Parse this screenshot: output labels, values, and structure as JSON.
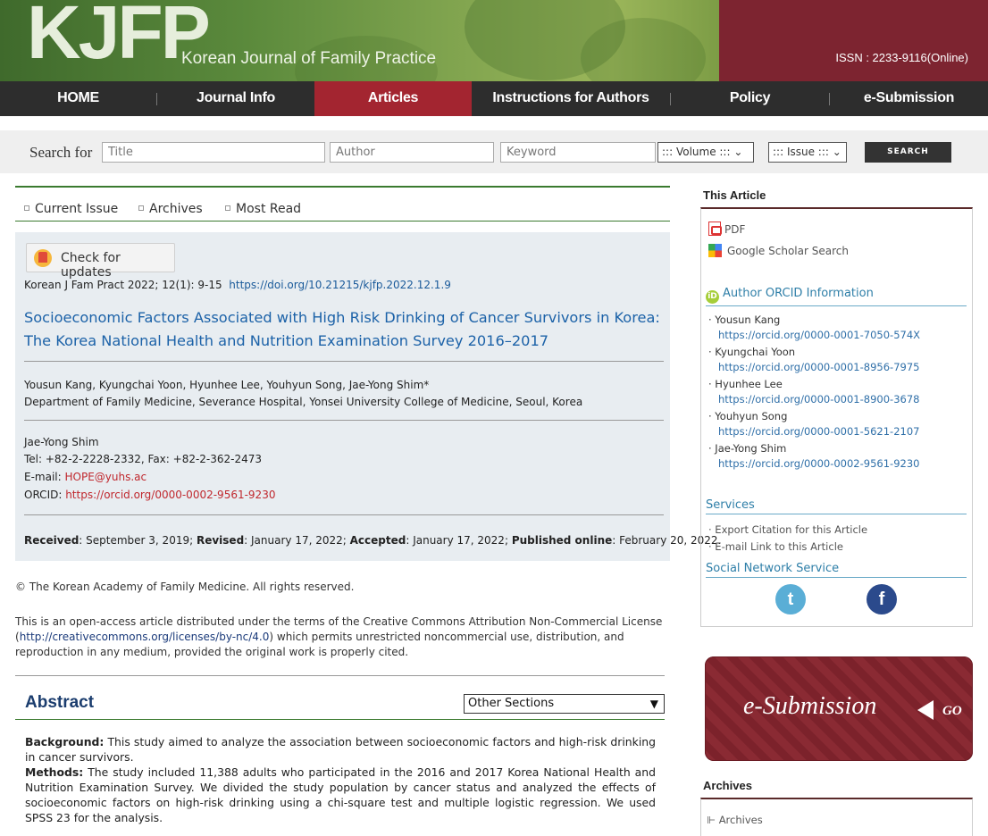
{
  "header": {
    "logo": "KJFP",
    "journal_name": "Korean Journal of Family Practice",
    "issn": "ISSN : 2233-9116(Online)"
  },
  "nav": {
    "items": [
      "HOME",
      "Journal Info",
      "Articles",
      "Instructions for Authors",
      "Policy",
      "e-Submission"
    ],
    "active": "Articles"
  },
  "search": {
    "label": "Search for",
    "title_placeholder": "Title",
    "author_placeholder": "Author",
    "keyword_placeholder": "Keyword",
    "volume_select": "::: Volume :::",
    "issue_select": "::: Issue :::",
    "button": "SEARCH"
  },
  "subnav": {
    "items": [
      "Current Issue",
      "Archives",
      "Most Read"
    ]
  },
  "article": {
    "check_updates": "Check for updates",
    "citation_text": "Korean J Fam Pract 2022; 12(1): 9-15",
    "doi": "https://doi.org/10.21215/kjfp.2022.12.1.9",
    "title": "Socioeconomic Factors Associated with High Risk Drinking of Cancer Survivors in Korea: The Korea National Health and Nutrition Examination Survey 2016–2017",
    "authors": "Yousun Kang, Kyungchai Yoon, Hyunhee Lee, Youhyun Song, Jae-Yong Shim*",
    "affiliation": "Department of Family Medicine, Severance Hospital, Yonsei University College of Medicine, Seoul, Korea",
    "corresponding": {
      "name": "Jae-Yong Shim",
      "tel": "Tel: +82-2-2228-2332, Fax: +82-2-362-2473",
      "email_label": "E-mail: ",
      "email": "HOPE@yuhs.ac",
      "orcid_label": "ORCID: ",
      "orcid": "https://orcid.org/0000-0002-9561-9230"
    },
    "dates": {
      "received_label": "Received",
      "received": ": September 3, 2019; ",
      "revised_label": "Revised",
      "revised": ": January 17, 2022; ",
      "accepted_label": "Accepted",
      "accepted": ": January 17, 2022; ",
      "published_label": "Published online",
      "published": ": February 20, 2022."
    },
    "copyright": "© The Korean Academy of Family Medicine. All rights reserved.",
    "license_pre": "This is an open-access article distributed under the terms of the Creative Commons Attribution Non-Commercial License (",
    "license_link": "http://creativecommons.org/licenses/by-nc/4.0",
    "license_post": ") which permits unrestricted noncommercial use, distribution, and reproduction in any medium, provided the original work is properly cited."
  },
  "abstract": {
    "title": "Abstract",
    "sections_select": "Other Sections",
    "background_label": "Background:",
    "background": " This study aimed to analyze the association between socioeconomic factors and high-risk drinking in cancer survivors.",
    "methods_label": "Methods:",
    "methods": " The study included 11,388 adults who participated in the 2016 and 2017 Korea National Health and Nutrition Examination Survey. We divided the study population by cancer status and analyzed the effects of socioeconomic factors on high-risk drinking using a chi-square test and multiple logistic regression. We used SPSS 23 for the analysis."
  },
  "sidebar": {
    "this_article": "This Article",
    "pdf": "PDF",
    "scholar": "Google Scholar Search",
    "orcid_title": "Author ORCID Information",
    "orcid_icon": "iD",
    "authors": [
      {
        "name": "· Yousun Kang",
        "url": "https://orcid.org/0000-0001-7050-574X"
      },
      {
        "name": "· Kyungchai Yoon",
        "url": "https://orcid.org/0000-0001-8956-7975"
      },
      {
        "name": "· Hyunhee Lee",
        "url": "https://orcid.org/0000-0001-8900-3678"
      },
      {
        "name": "· Youhyun Song",
        "url": "https://orcid.org/0000-0001-5621-2107"
      },
      {
        "name": "· Jae-Yong Shim",
        "url": "https://orcid.org/0000-0002-9561-9230"
      }
    ],
    "services_title": "Services",
    "services": [
      "· Export Citation for this Article",
      "· E-mail Link to this Article"
    ],
    "social_title": "Social Network Service",
    "twitter": "t",
    "facebook": "f",
    "esubmission": "e-Submission",
    "go": "GO",
    "archives_title": "Archives",
    "archives_link": "Archives"
  },
  "colors": {
    "nav_bg": "#2d2d2d",
    "nav_active": "#a32530",
    "title_blue": "#1c62a8",
    "link_red": "#c0282e",
    "green_rule": "#3a7a2f"
  }
}
